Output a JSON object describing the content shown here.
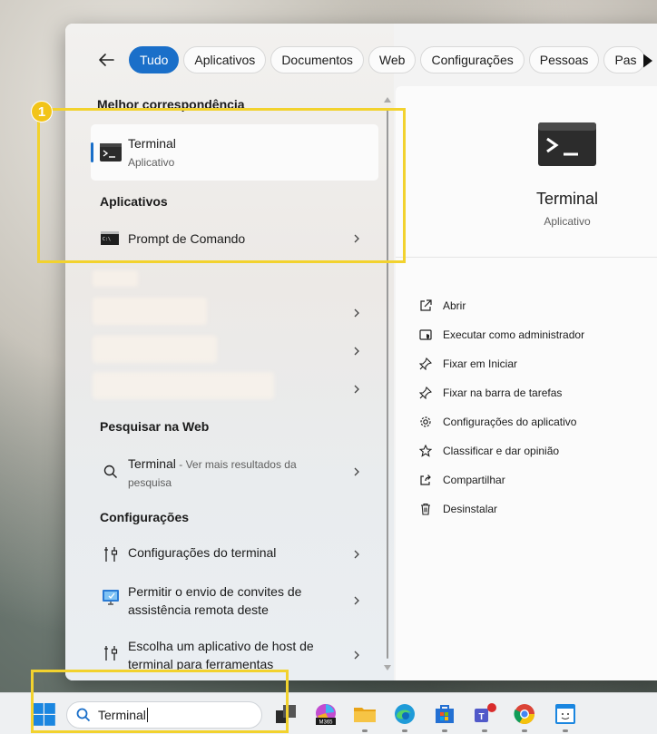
{
  "filters": {
    "back_label": "Voltar",
    "chips": [
      "Tudo",
      "Aplicativos",
      "Documentos",
      "Web",
      "Configurações",
      "Pessoas",
      "Pas"
    ]
  },
  "best_match": {
    "heading": "Melhor correspondência",
    "name": "Terminal",
    "type": "Aplicativo"
  },
  "apps": {
    "heading": "Aplicativos",
    "items": [
      "Prompt de Comando"
    ]
  },
  "web": {
    "heading": "Pesquisar na Web",
    "query": "Terminal",
    "suffix": " - Ver mais resultados da pesquisa"
  },
  "settings": {
    "heading": "Configurações",
    "items": [
      "Configurações do terminal",
      "Permitir o envio de convites de assistência remota deste",
      "Escolha um aplicativo de host de terminal para ferramentas"
    ]
  },
  "detail": {
    "title": "Terminal",
    "subtitle": "Aplicativo",
    "actions": [
      {
        "label": "Abrir",
        "icon": "open-external-icon"
      },
      {
        "label": "Executar como administrador",
        "icon": "shield-admin-icon"
      },
      {
        "label": "Fixar em Iniciar",
        "icon": "pin-icon"
      },
      {
        "label": "Fixar na barra de tarefas",
        "icon": "pin-icon"
      },
      {
        "label": "Configurações do aplicativo",
        "icon": "gear-icon"
      },
      {
        "label": "Classificar e dar opinião",
        "icon": "star-icon"
      },
      {
        "label": "Compartilhar",
        "icon": "share-icon"
      },
      {
        "label": "Desinstalar",
        "icon": "trash-icon"
      }
    ]
  },
  "annotation": {
    "badge": "1",
    "color": "#f2d22e"
  },
  "taskbar": {
    "search_value": "Terminal",
    "apps": [
      "Iniciar",
      "Visão de tarefas",
      "Microsoft 365",
      "Explorador de Arquivos",
      "Microsoft Edge",
      "Microsoft Store",
      "Microsoft Teams",
      "Google Chrome",
      "Aplicativo"
    ],
    "m365_label": "M365"
  },
  "colors": {
    "accent": "#1a6fc9",
    "highlight": "#f2d22e"
  }
}
